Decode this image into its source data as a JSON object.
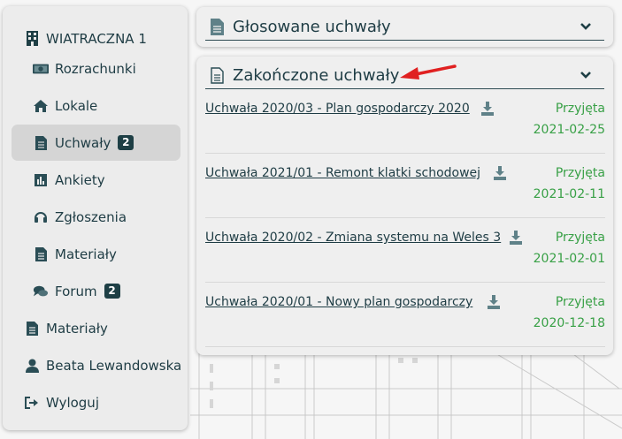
{
  "sidebar": {
    "building": "WIATRACZNA 1",
    "items": [
      {
        "label": "Rozrachunki",
        "icon": "money-icon"
      },
      {
        "label": "Lokale",
        "icon": "home-icon"
      },
      {
        "label": "Uchwały",
        "icon": "document-icon",
        "badge": "2",
        "active": true
      },
      {
        "label": "Ankiety",
        "icon": "bar-chart-icon"
      },
      {
        "label": "Zgłoszenia",
        "icon": "headset-icon"
      },
      {
        "label": "Materiały",
        "icon": "document-icon"
      },
      {
        "label": "Forum",
        "icon": "chat-icon",
        "badge": "2"
      }
    ],
    "materials": "Materiały",
    "user": "Beata Lewandowska",
    "logout": "Wyloguj"
  },
  "voted_panel": {
    "title": "Głosowane uchwały"
  },
  "closed_panel": {
    "title": "Zakończone uchwały",
    "rows": [
      {
        "name": "Uchwała 2020/03 - Plan gospodarczy 2020",
        "status": "Przyjęta",
        "date": "2021-02-25"
      },
      {
        "name": "Uchwała 2021/01 - Remont klatki schodowej",
        "status": "Przyjęta",
        "date": "2021-02-11"
      },
      {
        "name": "Uchwała 2020/02 - Zmiana systemu na Weles 3",
        "status": "Przyjęta",
        "date": "2021-02-01"
      },
      {
        "name": "Uchwała 2020/01 - Nowy plan gospodarczy",
        "status": "Przyjęta",
        "date": "2020-12-18"
      }
    ]
  },
  "colors": {
    "accent": "#1e3f45",
    "status_green": "#38a046",
    "arrow_red": "#e02020"
  }
}
